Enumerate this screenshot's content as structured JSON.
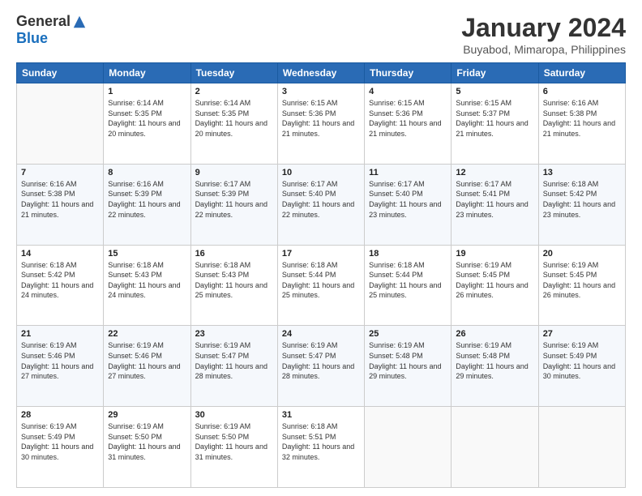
{
  "header": {
    "logo_general": "General",
    "logo_blue": "Blue",
    "title": "January 2024",
    "location": "Buyabod, Mimaropa, Philippines"
  },
  "weekdays": [
    "Sunday",
    "Monday",
    "Tuesday",
    "Wednesday",
    "Thursday",
    "Friday",
    "Saturday"
  ],
  "weeks": [
    [
      {
        "day": "",
        "sunrise": "",
        "sunset": "",
        "daylight": ""
      },
      {
        "day": "1",
        "sunrise": "Sunrise: 6:14 AM",
        "sunset": "Sunset: 5:35 PM",
        "daylight": "Daylight: 11 hours and 20 minutes."
      },
      {
        "day": "2",
        "sunrise": "Sunrise: 6:14 AM",
        "sunset": "Sunset: 5:35 PM",
        "daylight": "Daylight: 11 hours and 20 minutes."
      },
      {
        "day": "3",
        "sunrise": "Sunrise: 6:15 AM",
        "sunset": "Sunset: 5:36 PM",
        "daylight": "Daylight: 11 hours and 21 minutes."
      },
      {
        "day": "4",
        "sunrise": "Sunrise: 6:15 AM",
        "sunset": "Sunset: 5:36 PM",
        "daylight": "Daylight: 11 hours and 21 minutes."
      },
      {
        "day": "5",
        "sunrise": "Sunrise: 6:15 AM",
        "sunset": "Sunset: 5:37 PM",
        "daylight": "Daylight: 11 hours and 21 minutes."
      },
      {
        "day": "6",
        "sunrise": "Sunrise: 6:16 AM",
        "sunset": "Sunset: 5:38 PM",
        "daylight": "Daylight: 11 hours and 21 minutes."
      }
    ],
    [
      {
        "day": "7",
        "sunrise": "Sunrise: 6:16 AM",
        "sunset": "Sunset: 5:38 PM",
        "daylight": "Daylight: 11 hours and 21 minutes."
      },
      {
        "day": "8",
        "sunrise": "Sunrise: 6:16 AM",
        "sunset": "Sunset: 5:39 PM",
        "daylight": "Daylight: 11 hours and 22 minutes."
      },
      {
        "day": "9",
        "sunrise": "Sunrise: 6:17 AM",
        "sunset": "Sunset: 5:39 PM",
        "daylight": "Daylight: 11 hours and 22 minutes."
      },
      {
        "day": "10",
        "sunrise": "Sunrise: 6:17 AM",
        "sunset": "Sunset: 5:40 PM",
        "daylight": "Daylight: 11 hours and 22 minutes."
      },
      {
        "day": "11",
        "sunrise": "Sunrise: 6:17 AM",
        "sunset": "Sunset: 5:40 PM",
        "daylight": "Daylight: 11 hours and 23 minutes."
      },
      {
        "day": "12",
        "sunrise": "Sunrise: 6:17 AM",
        "sunset": "Sunset: 5:41 PM",
        "daylight": "Daylight: 11 hours and 23 minutes."
      },
      {
        "day": "13",
        "sunrise": "Sunrise: 6:18 AM",
        "sunset": "Sunset: 5:42 PM",
        "daylight": "Daylight: 11 hours and 23 minutes."
      }
    ],
    [
      {
        "day": "14",
        "sunrise": "Sunrise: 6:18 AM",
        "sunset": "Sunset: 5:42 PM",
        "daylight": "Daylight: 11 hours and 24 minutes."
      },
      {
        "day": "15",
        "sunrise": "Sunrise: 6:18 AM",
        "sunset": "Sunset: 5:43 PM",
        "daylight": "Daylight: 11 hours and 24 minutes."
      },
      {
        "day": "16",
        "sunrise": "Sunrise: 6:18 AM",
        "sunset": "Sunset: 5:43 PM",
        "daylight": "Daylight: 11 hours and 25 minutes."
      },
      {
        "day": "17",
        "sunrise": "Sunrise: 6:18 AM",
        "sunset": "Sunset: 5:44 PM",
        "daylight": "Daylight: 11 hours and 25 minutes."
      },
      {
        "day": "18",
        "sunrise": "Sunrise: 6:18 AM",
        "sunset": "Sunset: 5:44 PM",
        "daylight": "Daylight: 11 hours and 25 minutes."
      },
      {
        "day": "19",
        "sunrise": "Sunrise: 6:19 AM",
        "sunset": "Sunset: 5:45 PM",
        "daylight": "Daylight: 11 hours and 26 minutes."
      },
      {
        "day": "20",
        "sunrise": "Sunrise: 6:19 AM",
        "sunset": "Sunset: 5:45 PM",
        "daylight": "Daylight: 11 hours and 26 minutes."
      }
    ],
    [
      {
        "day": "21",
        "sunrise": "Sunrise: 6:19 AM",
        "sunset": "Sunset: 5:46 PM",
        "daylight": "Daylight: 11 hours and 27 minutes."
      },
      {
        "day": "22",
        "sunrise": "Sunrise: 6:19 AM",
        "sunset": "Sunset: 5:46 PM",
        "daylight": "Daylight: 11 hours and 27 minutes."
      },
      {
        "day": "23",
        "sunrise": "Sunrise: 6:19 AM",
        "sunset": "Sunset: 5:47 PM",
        "daylight": "Daylight: 11 hours and 28 minutes."
      },
      {
        "day": "24",
        "sunrise": "Sunrise: 6:19 AM",
        "sunset": "Sunset: 5:47 PM",
        "daylight": "Daylight: 11 hours and 28 minutes."
      },
      {
        "day": "25",
        "sunrise": "Sunrise: 6:19 AM",
        "sunset": "Sunset: 5:48 PM",
        "daylight": "Daylight: 11 hours and 29 minutes."
      },
      {
        "day": "26",
        "sunrise": "Sunrise: 6:19 AM",
        "sunset": "Sunset: 5:48 PM",
        "daylight": "Daylight: 11 hours and 29 minutes."
      },
      {
        "day": "27",
        "sunrise": "Sunrise: 6:19 AM",
        "sunset": "Sunset: 5:49 PM",
        "daylight": "Daylight: 11 hours and 30 minutes."
      }
    ],
    [
      {
        "day": "28",
        "sunrise": "Sunrise: 6:19 AM",
        "sunset": "Sunset: 5:49 PM",
        "daylight": "Daylight: 11 hours and 30 minutes."
      },
      {
        "day": "29",
        "sunrise": "Sunrise: 6:19 AM",
        "sunset": "Sunset: 5:50 PM",
        "daylight": "Daylight: 11 hours and 31 minutes."
      },
      {
        "day": "30",
        "sunrise": "Sunrise: 6:19 AM",
        "sunset": "Sunset: 5:50 PM",
        "daylight": "Daylight: 11 hours and 31 minutes."
      },
      {
        "day": "31",
        "sunrise": "Sunrise: 6:18 AM",
        "sunset": "Sunset: 5:51 PM",
        "daylight": "Daylight: 11 hours and 32 minutes."
      },
      {
        "day": "",
        "sunrise": "",
        "sunset": "",
        "daylight": ""
      },
      {
        "day": "",
        "sunrise": "",
        "sunset": "",
        "daylight": ""
      },
      {
        "day": "",
        "sunrise": "",
        "sunset": "",
        "daylight": ""
      }
    ]
  ]
}
